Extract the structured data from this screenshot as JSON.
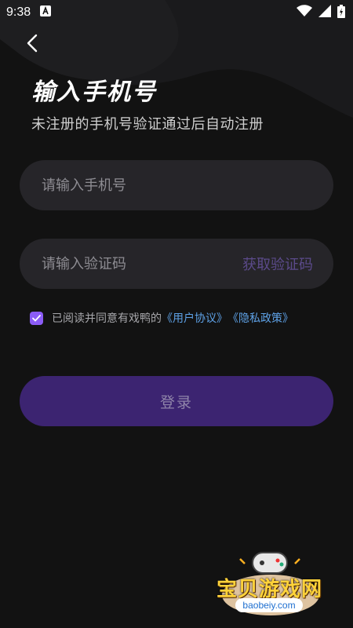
{
  "status_bar": {
    "time": "9:38",
    "notification_icon": "a-badge-icon",
    "icons": [
      "wifi-icon",
      "signal-icon",
      "battery-icon"
    ]
  },
  "header": {
    "back_icon": "chevron-left-icon",
    "title": "输入手机号",
    "subtitle": "未注册的手机号验证通过后自动注册"
  },
  "form": {
    "phone_placeholder": "请输入手机号",
    "code_placeholder": "请输入验证码",
    "get_code_label": "获取验证码"
  },
  "agreement": {
    "checked": true,
    "text": "已阅读并同意有戏鸭的",
    "user_agreement": "《用户协议》",
    "privacy_policy": "《隐私政策》"
  },
  "login_button": {
    "label": "登录"
  },
  "watermark": {
    "brand": "宝贝游戏网",
    "url": "baobeiy.com"
  },
  "colors": {
    "background": "#121212",
    "input_bg": "#262529",
    "accent_purple": "#8b5cf6",
    "login_bg": "#3c2471",
    "link_blue": "#5ea1e6"
  }
}
